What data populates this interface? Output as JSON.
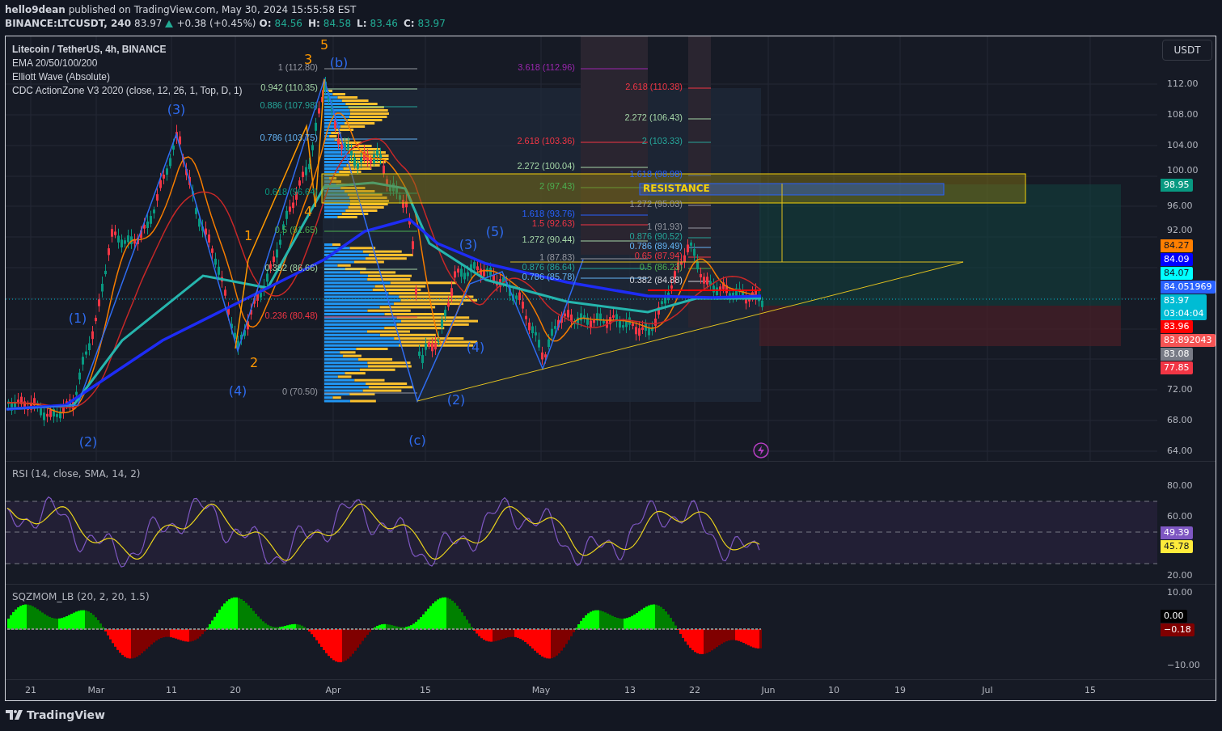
{
  "header": {
    "published_line": "**hello9dean** published on TradingView.com, May 30, 2024 15:55:58 EST",
    "symbol": "BINANCE:LTCUSDT, 240",
    "last": "83.97",
    "change": "+0.38 (+0.45%)",
    "ohlc": [
      {
        "label": "O:",
        "value": "84.56"
      },
      {
        "label": "H:",
        "value": "84.58"
      },
      {
        "label": "L:",
        "value": "83.46"
      },
      {
        "label": "C:",
        "value": "83.97"
      }
    ]
  },
  "legend": [
    "Litecoin / TetherUS, 4h, BINANCE",
    "EMA 20/50/100/200",
    "Elliott Wave (Absolute)",
    "CDC ActionZone V3 2020 (close, 12, 26, 1, Top, D, 1)"
  ],
  "currency_button": "USDT",
  "price_axis": [
    "112.00",
    "108.00",
    "104.00",
    "100.00",
    "96.00",
    "92.00",
    "72.00",
    "68.00",
    "64.00"
  ],
  "price_tags": [
    {
      "value": "98.95",
      "color": "#089981"
    },
    {
      "value": "84.27",
      "color": "#ff7f00"
    },
    {
      "value": "84.09",
      "color": "#0000ff"
    },
    {
      "value": "84.07",
      "color": "#00ffff"
    },
    {
      "value": "84.051969",
      "color": "#2962ff"
    },
    {
      "value": "83.97",
      "countdown": "03:04:04",
      "color": "#00bcd4"
    },
    {
      "value": "83.96",
      "color": "#ff0000"
    },
    {
      "value": "83.892043",
      "color": "#f55454"
    },
    {
      "value": "83.08",
      "color": "#787b86"
    },
    {
      "value": "77.85",
      "color": "#f23645"
    }
  ],
  "resistance_label": "RESISTANCE",
  "fib_sets": [
    {
      "labels": [
        {
          "text": "1 (112.80)",
          "color": "#9598a1"
        },
        {
          "text": "0.942 (110.35)",
          "color": "#a5d6a7"
        },
        {
          "text": "0.886 (107.98)",
          "color": "#26a69a"
        },
        {
          "text": "0.786 (103.75)",
          "color": "#64b5f6"
        },
        {
          "text": "0.618 (96.64)",
          "color": "#089981"
        },
        {
          "text": "0.5 (91.65)",
          "color": "#4caf50"
        },
        {
          "text": "0.382 (86.66)",
          "color": "#a5d6a7"
        },
        {
          "text": "0.236 (80.48)",
          "color": "#f23645"
        },
        {
          "text": "0 (70.50)",
          "color": "#9598a1"
        }
      ]
    },
    {
      "labels": [
        {
          "text": "3.618 (112.96)",
          "color": "#9c27b0"
        },
        {
          "text": "2.618 (103.36)",
          "color": "#f23645"
        },
        {
          "text": "2.272 (100.04)",
          "color": "#a5d6a7"
        },
        {
          "text": "2 (97.43)",
          "color": "#4caf50"
        },
        {
          "text": "1.618 (93.76)",
          "color": "#2962ff"
        },
        {
          "text": "1.5 (92.63)",
          "color": "#f23645"
        },
        {
          "text": "1.272 (90.44)",
          "color": "#a5d6a7"
        },
        {
          "text": "1 (87.83)",
          "color": "#9598a1"
        },
        {
          "text": "0.876 (86.64)",
          "color": "#26a69a"
        },
        {
          "text": "0.786 (85.78)",
          "color": "#64b5f6"
        }
      ]
    },
    {
      "labels": [
        {
          "text": "2.618 (110.38)",
          "color": "#f23645"
        },
        {
          "text": "2.272 (106.43)",
          "color": "#a5d6a7"
        },
        {
          "text": "2 (103.33)",
          "color": "#26a69a"
        },
        {
          "text": "1.618 (98.98)",
          "color": "#2962ff"
        },
        {
          "text": "1.272 (95.03)",
          "color": "#9598a1"
        },
        {
          "text": "1 (91.93)",
          "color": "#9598a1"
        },
        {
          "text": "0.876 (90.52)",
          "color": "#26a69a"
        },
        {
          "text": "0.786 (89.49)",
          "color": "#64b5f6"
        },
        {
          "text": "0.65 (87.94)",
          "color": "#f23645"
        },
        {
          "text": "0.5 (86.23)",
          "color": "#4caf50"
        },
        {
          "text": "0.382 (84.88)",
          "color": "#d1d4dc"
        }
      ]
    }
  ],
  "wave_labels": [
    {
      "text": "5",
      "color": "#ff9800"
    },
    {
      "text": "3",
      "color": "#ff9800"
    },
    {
      "text": "1",
      "color": "#ff9800"
    },
    {
      "text": "4",
      "color": "#ff9800"
    },
    {
      "text": "2",
      "color": "#ff9800"
    },
    {
      "text": "(b)",
      "color": "#2f6cf0"
    },
    {
      "text": "(3)",
      "color": "#2f6cf0"
    },
    {
      "text": "(1)",
      "color": "#2f6cf0"
    },
    {
      "text": "(2)",
      "color": "#2f6cf0"
    },
    {
      "text": "(4)",
      "color": "#2f6cf0"
    },
    {
      "text": "(c)",
      "color": "#2f6cf0"
    },
    {
      "text": "(2)",
      "color": "#2f6cf0"
    },
    {
      "text": "(3)",
      "color": "#2f6cf0"
    },
    {
      "text": "(5)",
      "color": "#2f6cf0"
    },
    {
      "text": "(4)",
      "color": "#2f6cf0"
    }
  ],
  "rsi": {
    "title": "RSI (14, close, SMA, 14, 2)",
    "axis": [
      "80.00",
      "60.00",
      "20.00"
    ],
    "tags": [
      {
        "value": "49.39",
        "color": "#7e57c2"
      },
      {
        "value": "45.78",
        "color": "#ffeb3b"
      }
    ]
  },
  "squeeze": {
    "title": "SQZMOM_LB (20, 2, 20, 1.5)",
    "axis": [
      "10.00",
      "−10.00"
    ],
    "tags": [
      {
        "value": "0.00",
        "color": "#000000"
      },
      {
        "value": "−0.18",
        "color": "#800000"
      }
    ]
  },
  "time_axis": [
    "21",
    "Mar",
    "11",
    "20",
    "Apr",
    "15",
    "May",
    "13",
    "22",
    "Jun",
    "10",
    "19",
    "Jul",
    "15"
  ],
  "footer": {
    "logo": "TradingView"
  }
}
